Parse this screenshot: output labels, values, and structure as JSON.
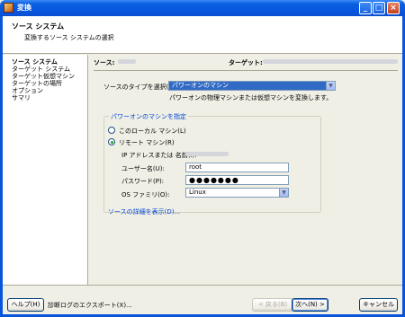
{
  "window": {
    "title": "変換"
  },
  "header": {
    "title": "ソース システム",
    "subtitle": "変換するソース システムの選択"
  },
  "steps": [
    {
      "label": "ソース システム",
      "active": true
    },
    {
      "label": "ターゲット システム",
      "active": false
    },
    {
      "label": "ターゲット仮想マシン",
      "active": false
    },
    {
      "label": "ターゲットの場所",
      "active": false
    },
    {
      "label": "オプション",
      "active": false
    },
    {
      "label": "サマリ",
      "active": false
    }
  ],
  "source_bar": {
    "source_label": "ソース:",
    "target_label": "ターゲット:"
  },
  "source_type": {
    "label": "ソースのタイプを選択(T):",
    "selected": "パワーオンのマシン",
    "description": "パワーオンの物理マシンまたは仮想マシンを変換します。"
  },
  "powered_on": {
    "group_title": "パワーオンのマシンを指定",
    "local_label": "このローカル マシン(L)",
    "remote_label": "リモート マシン(R)",
    "remote_selected": true,
    "ip_label": "IP アドレスまたは 名前(I):",
    "user_label": "ユーザー名(U):",
    "user_value": "root",
    "password_label": "パスワード(P):",
    "password_value": "●●●●●●●",
    "os_label": "OS ファミリ(O):",
    "os_value": "Linux"
  },
  "details_link": "ソースの詳細を表示(D)...",
  "footer": {
    "help": "ヘルプ(H)",
    "export": "診断ログのエクスポート(X)...",
    "back": "< 戻る(B)",
    "next": "次へ(N) >",
    "cancel": "キャンセル"
  },
  "colors": {
    "titlebar": "#0855dd",
    "selection": "#316ac5",
    "link": "#0046d5"
  }
}
